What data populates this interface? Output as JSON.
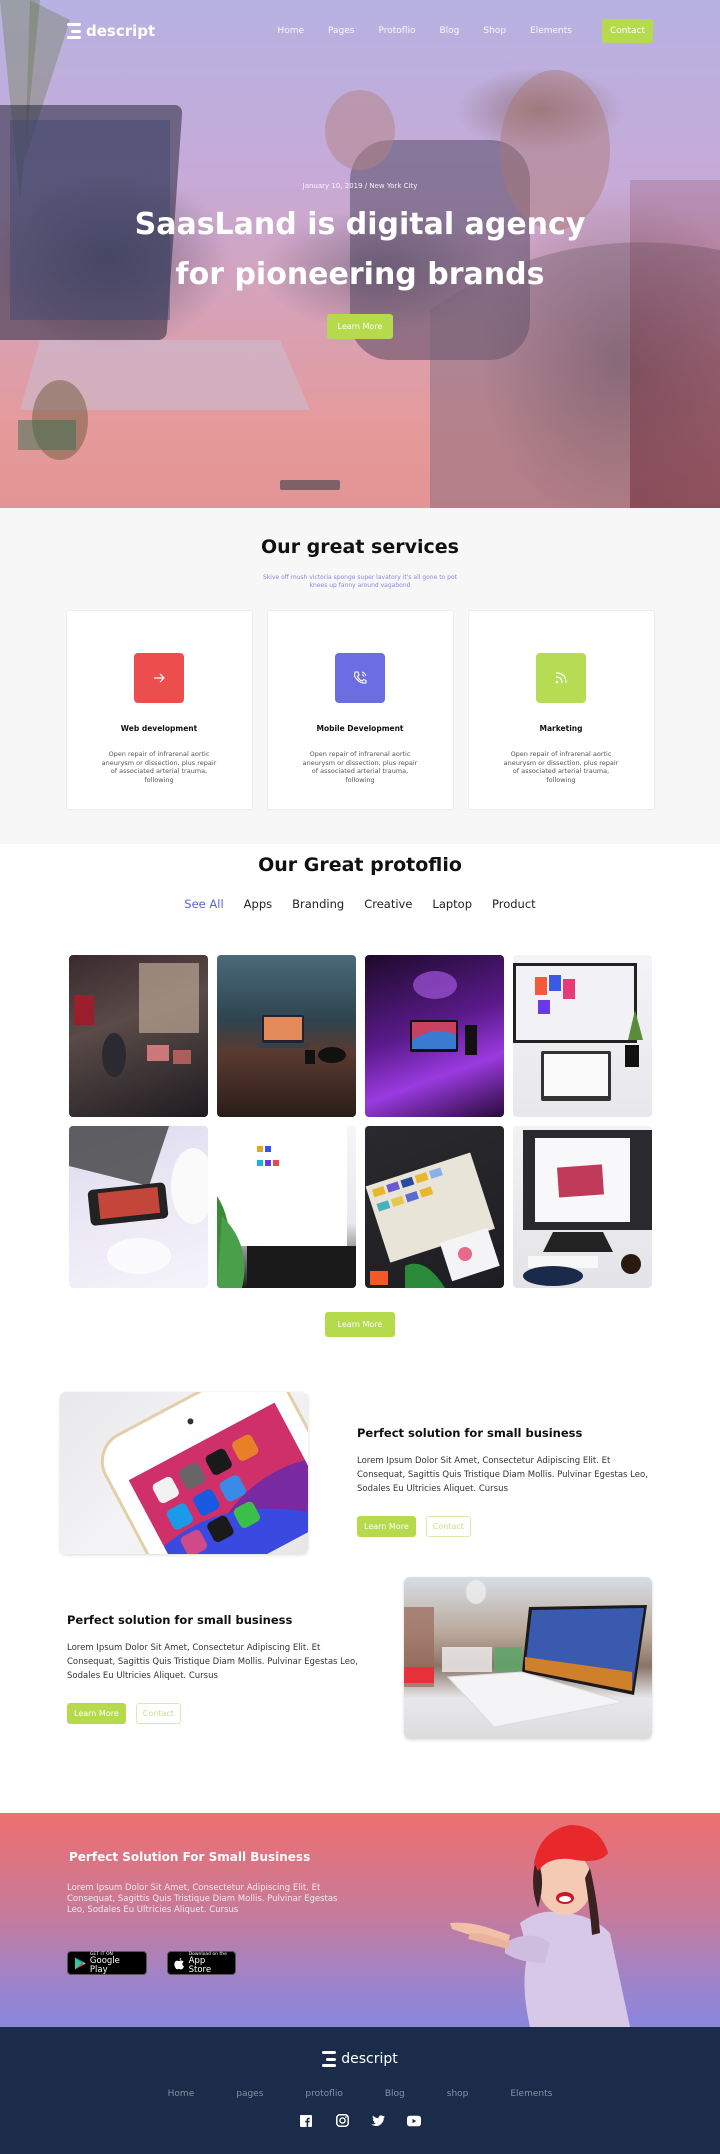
{
  "colors": {
    "accent": "#b5db4c",
    "tab_active": "#5b5fde",
    "web": "#ec4e4e",
    "mobile": "#6a6ee2",
    "marketing": "#b6dc54",
    "footer": "#1a2c4a"
  },
  "nav": {
    "logo": "descript",
    "links": [
      "Home",
      "Pages",
      "Protoflio",
      "Blog",
      "Shop",
      "Elements"
    ],
    "contact": "Contact"
  },
  "hero": {
    "date": "January 10, 2019 / New York City",
    "title_line1": "SaasLand is digital agency",
    "title_line2": "for pioneering brands",
    "cta": "Learn More"
  },
  "services": {
    "title": "Our great services",
    "subtitle_line1": "Skive off mush victoria sponge super lavatory it's all gone to pot",
    "subtitle_line2": "knees up fanny around vagabond",
    "cards": [
      {
        "icon": "arrow-right-icon",
        "title": "Web development",
        "desc": "Open repair of infrarenal aortic aneurysm or dissection, plus repair of associated arterial trauma, following"
      },
      {
        "icon": "phone-call-icon",
        "title": "Mobile Development",
        "desc": "Open repair of infrarenal aortic aneurysm or dissection, plus repair of associated arterial trauma, following"
      },
      {
        "icon": "rss-icon",
        "title": "Marketing",
        "desc": "Open repair of infrarenal aortic aneurysm or dissection, plus repair of associated arterial trauma, following"
      }
    ]
  },
  "portfolio": {
    "title": "Our Great protoflio",
    "tabs": [
      "See All",
      "Apps",
      "Branding",
      "Creative",
      "Laptop",
      "Product"
    ],
    "active_tab": "See All",
    "items": [
      "office-workstations",
      "laptop-city-desk",
      "purple-desk-setup",
      "monitor-laptop-designs",
      "phone-on-laptop",
      "imac-ui-kit",
      "color-swatches",
      "monitor-tablet-editing"
    ],
    "cta": "Learn More"
  },
  "features": [
    {
      "image": "iphone-apps",
      "title": "Perfect solution for small business",
      "body": "Lorem Ipsum Dolor Sit Amet, Consectetur Adipiscing Elit. Et Consequat, Sagittis Quis Tristique Diam Mollis. Pulvinar Egestas Leo, Sodales Eu Ultricies Aliquet. Cursus",
      "primary": "Learn More",
      "secondary": "Contact"
    },
    {
      "image": "laptop-paris",
      "title": "Perfect solution for small business",
      "body": "Lorem Ipsum Dolor Sit Amet, Consectetur Adipiscing Elit. Et Consequat, Sagittis Quis Tristique Diam Mollis. Pulvinar Egestas Leo, Sodales Eu Ultricies Aliquet. Cursus",
      "primary": "Learn More",
      "secondary": "Contact"
    }
  ],
  "cta": {
    "title": "Perfect Solution For Small Business",
    "body_line1": "Lorem Ipsum Dolor Sit Amet, Consectetur Adipiscing Elit. Et Consequat, Sagittis Quis Tristique Diam Mollis. Pulvinar Egestas",
    "body_line2": "Leo, Sodales Eu Ultricies Aliquet. Cursus",
    "google_small": "GET IT ON",
    "google_big": "Google Play",
    "apple_small": "Download on the",
    "apple_big": "App Store"
  },
  "footer": {
    "logo": "descript",
    "links": [
      "Home",
      "pages",
      "protoflio",
      "Blog",
      "shop",
      "Elements"
    ],
    "socials": [
      "facebook-icon",
      "instagram-icon",
      "twitter-icon",
      "youtube-icon"
    ]
  }
}
